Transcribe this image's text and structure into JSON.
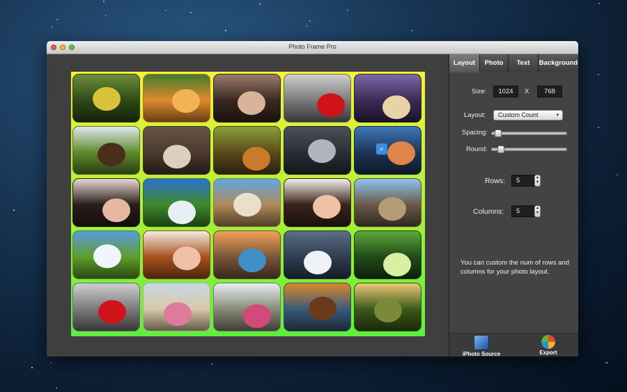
{
  "window": {
    "title": "Photo Frame Pro"
  },
  "panel": {
    "tabs": [
      {
        "label": "Layout"
      },
      {
        "label": "Photo"
      },
      {
        "label": "Text"
      },
      {
        "label": "Background"
      }
    ],
    "active_tab": "Layout",
    "size": {
      "label": "Size:",
      "width": "1024",
      "separator": "X",
      "height": "768"
    },
    "layout": {
      "label": "Layout:",
      "value": "Custom Count"
    },
    "spacing": {
      "label": "Spacing:",
      "value_fraction": 0.08
    },
    "round": {
      "label": "Round:",
      "value_fraction": 0.12
    },
    "rows": {
      "label": "Rows:",
      "value": "5"
    },
    "columns": {
      "label": "Columns:",
      "value": "5"
    },
    "hint": "You can custom the num of rows and columns for your photo layout."
  },
  "toolbar": {
    "iphoto_label": "iPhoto Source",
    "export_label": "Export"
  },
  "colors": {
    "board_gradient_top": "#f6f23a",
    "board_gradient_bottom": "#5cf03a",
    "panel_bg": "#434343",
    "tab_active": "#6b6b6b"
  },
  "grid": {
    "rows": 5,
    "columns": 5,
    "selected_cell": "row1-col5",
    "photos": [
      [
        "girl-in-flowers",
        "orange-kitten",
        "woman-portrait",
        "red-sports-car",
        "fantasy-art"
      ],
      [
        "turkey",
        "wooden-table-cup",
        "autumn-forest-path",
        "silver-sports-car",
        "lake-sunset"
      ],
      [
        "girl-portrait",
        "mountain-meadow",
        "beach-rocks",
        "girl-lying-down",
        "castle-bridge"
      ],
      [
        "green-hills",
        "girl-smiling",
        "wooden-pier",
        "white-bird",
        "bamboo-forest"
      ],
      [
        "red-sports-car",
        "kids-at-beach",
        "kids-at-statue",
        "autumn-reflection",
        "rural-road"
      ]
    ]
  }
}
